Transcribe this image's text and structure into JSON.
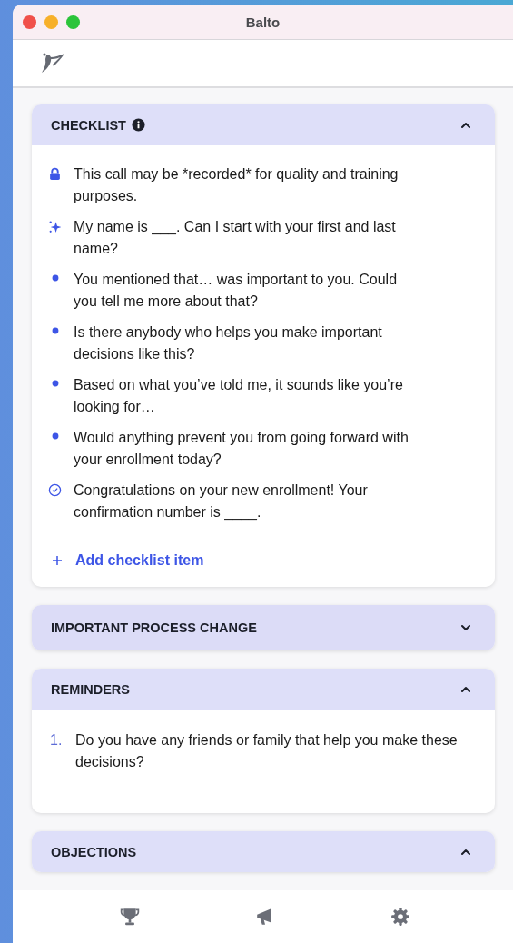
{
  "window": {
    "title": "Balto"
  },
  "sections": [
    {
      "kind": "checklist",
      "title": "CHECKLIST",
      "info": true,
      "expanded": true,
      "items": [
        {
          "kind": "lock",
          "text": "This call may be *recorded* for quality and training purposes."
        },
        {
          "kind": "sparkle",
          "text": "My name is ___. Can I start with your first and last name?"
        },
        {
          "kind": "dot",
          "text": "You mentioned that… was important to you. Could you tell me more about that?"
        },
        {
          "kind": "dot",
          "text": "Is there anybody who helps you make important decisions like this?"
        },
        {
          "kind": "dot",
          "text": "Based on what you’ve told me, it sounds like you’re looking for…"
        },
        {
          "kind": "dot",
          "text": "Would anything prevent you from going forward with your enrollment today?"
        },
        {
          "kind": "check",
          "text": "Congratulations on your new enrollment! Your confirmation number is ____."
        }
      ],
      "add_label": "Add checklist item"
    },
    {
      "title": "IMPORTANT PROCESS CHANGE",
      "expanded": false
    },
    {
      "kind": "numbered",
      "title": "REMINDERS",
      "expanded": true,
      "items": [
        {
          "number": "1.",
          "text": "Do you have any friends or family that help you make these decisions?"
        }
      ]
    },
    {
      "title": "OBJECTIONS",
      "expanded": true
    }
  ]
}
